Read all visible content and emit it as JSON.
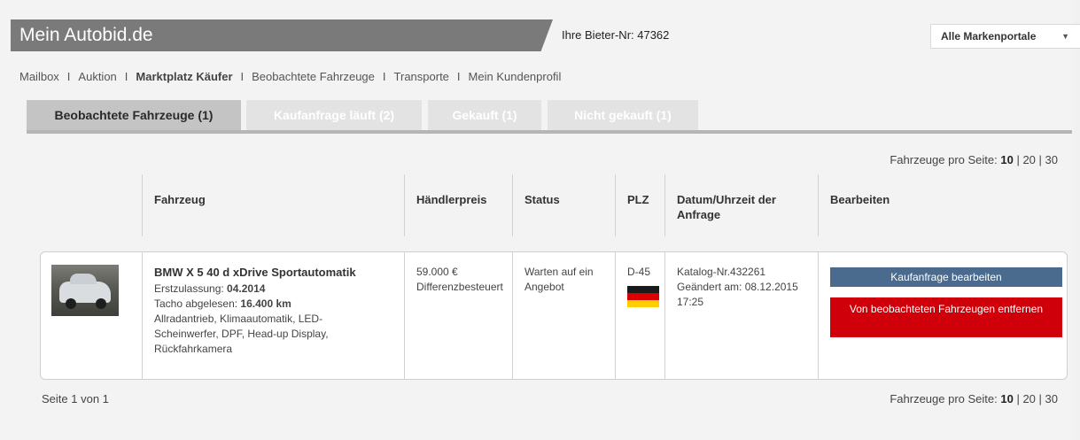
{
  "header": {
    "brand": "Mein Autobid.de",
    "bieter_label": "Ihre Bieter-Nr: 47362",
    "portal_select": "Alle Markenportale",
    "brand_bar_color": "#7a7a7a"
  },
  "nav": {
    "items": [
      {
        "label": "Mailbox"
      },
      {
        "label": "Auktion"
      },
      {
        "label": "Marktplatz Käufer",
        "active": true
      },
      {
        "label": "Beobachtete Fahrzeuge"
      },
      {
        "label": "Transporte"
      },
      {
        "label": "Mein Kundenprofil"
      }
    ]
  },
  "tabs": [
    {
      "label": "Beobachtete Fahrzeuge (1)",
      "active": true
    },
    {
      "label": "Kaufanfrage läuft (2)"
    },
    {
      "label": "Gekauft (1)"
    },
    {
      "label": "Nicht gekauft (1)"
    }
  ],
  "pagination": {
    "per_page_label": "Fahrzeuge pro Seite:",
    "options": [
      "10",
      "20",
      "30"
    ],
    "selected": "10",
    "page_info": "Seite 1 von 1"
  },
  "table": {
    "headers": [
      "Fahrzeug",
      "Händlerpreis",
      "Status",
      "PLZ",
      "Datum/Uhrzeit der Anfrage",
      "Bearbeiten"
    ],
    "rows": [
      {
        "vehicle_title": "BMW X 5 40 d xDrive Sportautomatik",
        "registration_label": "Erstzulassung:",
        "registration_value": "04.2014",
        "mileage_label": "Tacho abgelesen:",
        "mileage_value": "16.400 km",
        "features": "Allradantrieb, Klimaautomatik, LED-Scheinwerfer, DPF, Head-up Display, Rückfahrkamera",
        "price": "59.000 €",
        "price_note": "Differenzbesteuert",
        "status": "Warten auf ein Angebot",
        "plz": "D-45",
        "flag_icon": "germany-flag-icon",
        "catalog": "Katalog-Nr.432261",
        "changed": "Geändert am: 08.12.2015 17:25",
        "edit_button": "Kaufanfrage bearbeiten",
        "remove_button": "Von beobachteten Fahrzeugen entfernen"
      }
    ]
  },
  "colors": {
    "edit_button": "#4a6a8e",
    "remove_button": "#d0000a",
    "tab_active": "#c4c4c4",
    "tab_inactive": "#e3e3e3"
  }
}
